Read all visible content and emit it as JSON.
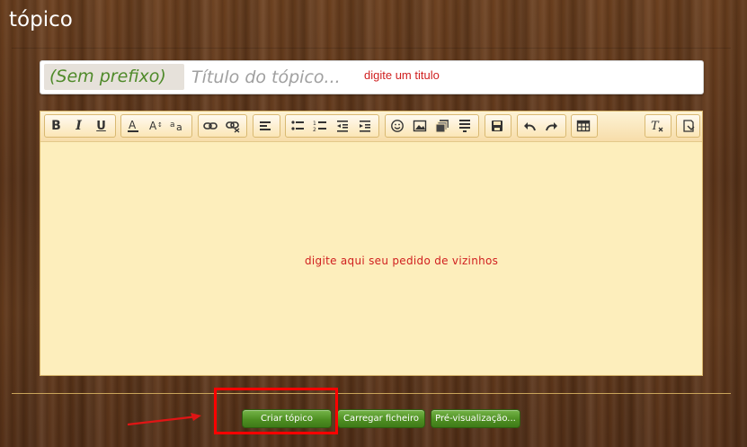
{
  "page": {
    "title": "tópico"
  },
  "title_field": {
    "prefix_label": "(Sem prefixo)",
    "placeholder": "Título do tópico...",
    "value": ""
  },
  "annotations": {
    "title_hint": "digite um titulo",
    "body_hint": "digite aqui seu pedido de vizinhos",
    "highlight_color": "#ff0000"
  },
  "toolbar": {
    "groups": [
      [
        "bold-icon",
        "italic-icon",
        "underline-icon"
      ],
      [
        "font-color-icon",
        "font-size-icon",
        "font-family-icon"
      ],
      [
        "link-icon",
        "unlink-icon"
      ],
      [
        "align-icon"
      ],
      [
        "bullet-list-icon",
        "numbered-list-icon",
        "outdent-icon",
        "indent-icon"
      ],
      [
        "smiley-icon",
        "image-icon",
        "media-icon",
        "code-icon"
      ],
      [
        "save-draft-icon"
      ],
      [
        "undo-icon",
        "redo-icon"
      ],
      [
        "table-icon"
      ],
      [
        "remove-format-icon"
      ],
      [
        "toggle-source-icon"
      ]
    ]
  },
  "buttons": {
    "create": "Criar tópico",
    "upload": "Carregar ficheiro",
    "preview": "Pré-visualização..."
  },
  "colors": {
    "editor_bg": "#fdeebc",
    "button_green": "#4e8f22",
    "prefix_text": "#4f8a2a",
    "hint_red": "#d02020"
  }
}
